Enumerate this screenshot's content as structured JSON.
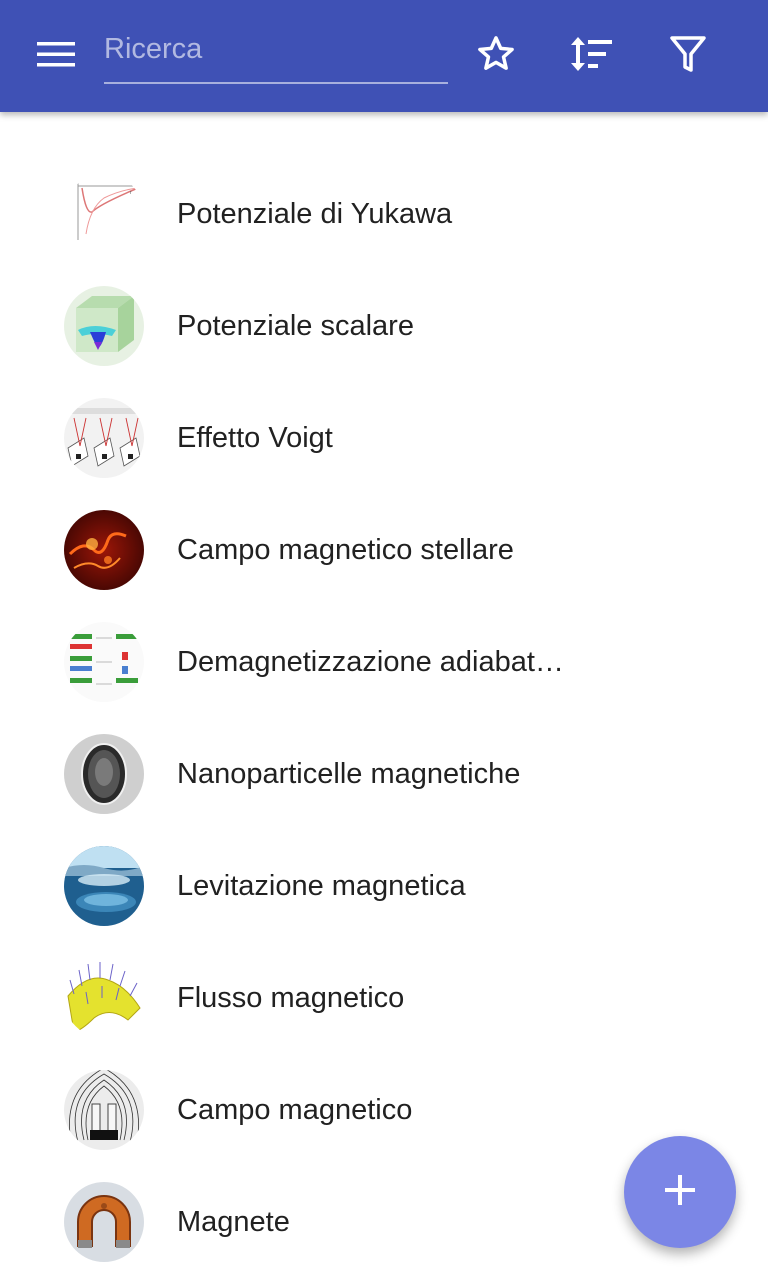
{
  "app_bar": {
    "background": "#3f51b5",
    "menu_icon": "menu-icon",
    "search": {
      "placeholder": "Ricerca",
      "value": ""
    },
    "actions": [
      "star-outline-icon",
      "sort-icon",
      "filter-icon"
    ]
  },
  "items": [
    {
      "label": "Potenziale di Yukawa",
      "icon": "yukawa-plot-thumbnail"
    },
    {
      "label": "Potenziale scalare",
      "icon": "scalar-potential-thumbnail"
    },
    {
      "label": "Effetto Voigt",
      "icon": "voigt-diagram-thumbnail"
    },
    {
      "label": "Campo magnetico stellare",
      "icon": "stellar-field-thumbnail"
    },
    {
      "label": "Demagnetizzazione adiabat…",
      "icon": "demagnetization-thumbnail"
    },
    {
      "label": "Nanoparticelle magnetiche",
      "icon": "nanoparticle-thumbnail"
    },
    {
      "label": "Levitazione magnetica",
      "icon": "levitation-thumbnail"
    },
    {
      "label": "Flusso magnetico",
      "icon": "flux-surface-thumbnail"
    },
    {
      "label": "Campo magnetico",
      "icon": "magnetic-field-thumbnail"
    },
    {
      "label": "Magnete",
      "icon": "horseshoe-magnet-thumbnail"
    }
  ],
  "fab": {
    "icon": "plus-icon",
    "color": "#7b86e6"
  }
}
